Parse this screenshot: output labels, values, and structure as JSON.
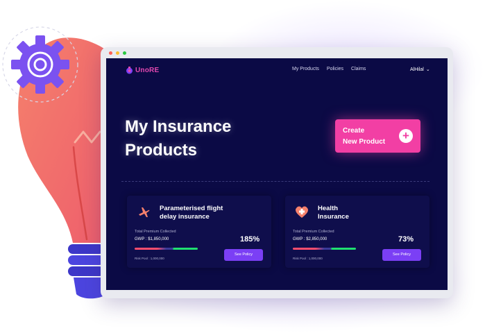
{
  "app": {
    "logo_text": "UnoRE",
    "nav": [
      "My Products",
      "Policies",
      "Claims"
    ],
    "user_name": "AlHilal",
    "user_caret": "⌄"
  },
  "page": {
    "title": "My Insurance Products",
    "create_button": {
      "line1": "Create",
      "line2": "New Product",
      "icon": "+"
    }
  },
  "cards": [
    {
      "icon": "airplane-icon",
      "title_line1": "Parameterised flight",
      "title_line2": "delay insurance",
      "premium_label": "Total Premium Collected",
      "gwp": "GWP : $1,850,000",
      "percent": "185%",
      "risk_pool": "Risk Pool : 1,000,000",
      "button": "See Policy"
    },
    {
      "icon": "heart-plus-icon",
      "title_line1": "Health",
      "title_line2": "Insurance",
      "premium_label": "Total Premium Collected",
      "gwp": "GWP : $2,850,000",
      "percent": "73%",
      "risk_pool": "Risk Pool : 1,000,000",
      "button": "See Policy"
    }
  ],
  "colors": {
    "screen_bg": "#0b0a45",
    "card_bg": "#0f0e4c",
    "accent_pink": "#f23fa4",
    "button_purple": "#7b3ff5",
    "bulb": "#f47567",
    "gear": "#7b52f0"
  }
}
